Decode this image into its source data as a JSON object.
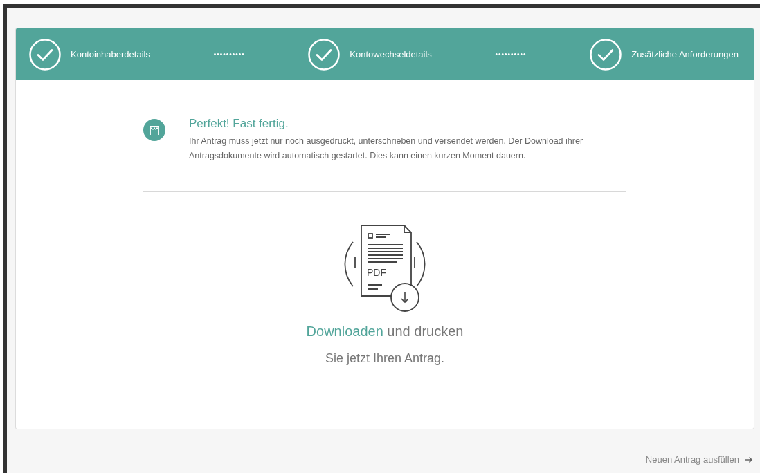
{
  "steps": [
    {
      "label": "Kontoinhaberdetails",
      "done": true
    },
    {
      "label": "Kontowechseldetails",
      "done": true
    },
    {
      "label": "Zusätzliche Anforderungen",
      "done": true
    }
  ],
  "separator": "••••••••••",
  "notice": {
    "title": "Perfekt! Fast fertig.",
    "text": "Ihr Antrag muss jetzt nur noch ausgedruckt, unterschrieben und versendet werden. Der Download ihrer Antragsdokumente wird automatisch gestartet. Dies kann einen kurzen Moment dauern."
  },
  "download": {
    "file_label": "PDF",
    "link": "Downloaden",
    "headline_rest": "und drucken",
    "subline": "Sie jetzt Ihren Antrag."
  },
  "footer_link": "Neuen Antrag ausfüllen"
}
